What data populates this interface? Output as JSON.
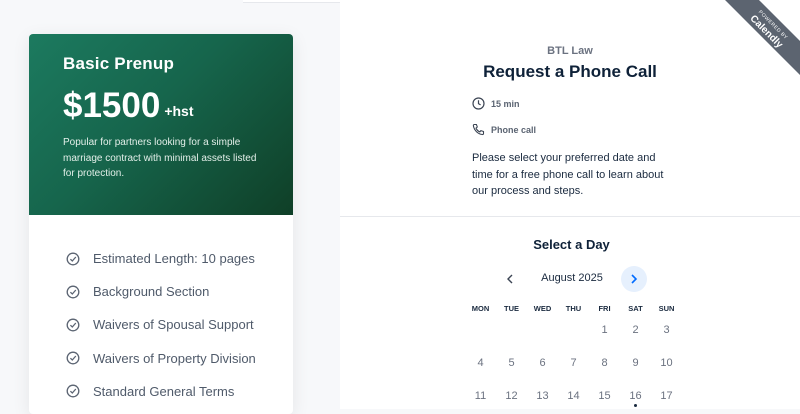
{
  "pricing_card": {
    "plan_name": "Basic Prenup",
    "price": "$1500",
    "price_suffix": "+hst",
    "description": "Popular for partners looking for a simple marriage contract with minimal assets listed for protection.",
    "features": [
      "Estimated Length: 10 pages",
      "Background Section",
      "Waivers of Spousal Support",
      "Waivers of Property Division",
      "Standard General Terms"
    ],
    "colors": {
      "gradient_start": "#1c7a5f",
      "gradient_end": "#0f3f27"
    },
    "feature_icon": "check-circle-icon"
  },
  "booking": {
    "badge_small": "POWERED BY",
    "badge_big": "Calendly",
    "organization": "BTL Law",
    "event_title": "Request a Phone Call",
    "duration": "15 min",
    "location": "Phone call",
    "description": "Please select your preferred date and time for a free phone call to learn about our process and steps.",
    "select_day_heading": "Select a Day",
    "month_label": "August 2025",
    "weekdays": [
      "MON",
      "TUE",
      "WED",
      "THU",
      "FRI",
      "SAT",
      "SUN"
    ],
    "weeks": [
      [
        "",
        "",
        "",
        "",
        "1",
        "2",
        "3"
      ],
      [
        "4",
        "5",
        "6",
        "7",
        "8",
        "9",
        "10"
      ],
      [
        "11",
        "12",
        "13",
        "14",
        "15",
        "16",
        "17"
      ]
    ],
    "today": "16",
    "accent": "#006bff"
  }
}
